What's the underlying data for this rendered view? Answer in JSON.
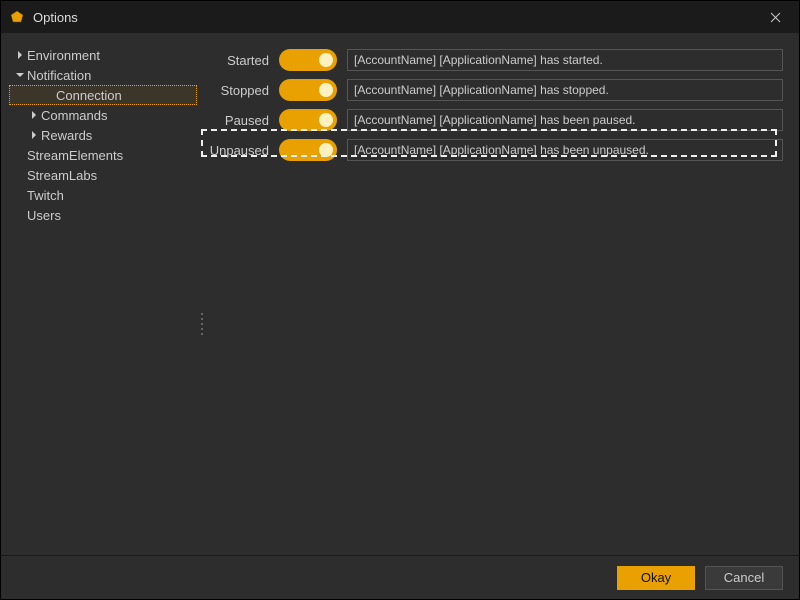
{
  "window": {
    "title": "Options"
  },
  "sidebar": {
    "items": [
      {
        "label": "Environment",
        "expanded": false,
        "level": 1
      },
      {
        "label": "Notification",
        "expanded": true,
        "level": 1
      },
      {
        "label": "Connection",
        "level": 2,
        "selected": true,
        "noarrow": true
      },
      {
        "label": "Commands",
        "expanded": false,
        "level": 2
      },
      {
        "label": "Rewards",
        "expanded": false,
        "level": 2
      },
      {
        "label": "StreamElements",
        "level": 1,
        "noarrow": true
      },
      {
        "label": "StreamLabs",
        "level": 1,
        "noarrow": true
      },
      {
        "label": "Twitch",
        "level": 1,
        "noarrow": true
      },
      {
        "label": "Users",
        "level": 1,
        "noarrow": true
      }
    ]
  },
  "settings": {
    "rows": [
      {
        "label": "Started",
        "value": "[AccountName] [ApplicationName] has started."
      },
      {
        "label": "Stopped",
        "value": "[AccountName] [ApplicationName] has stopped."
      },
      {
        "label": "Paused",
        "value": "[AccountName] [ApplicationName] has been paused."
      },
      {
        "label": "Unpaused",
        "value": "[AccountName] [ApplicationName] has been unpaused."
      }
    ]
  },
  "footer": {
    "ok": "Okay",
    "cancel": "Cancel"
  }
}
